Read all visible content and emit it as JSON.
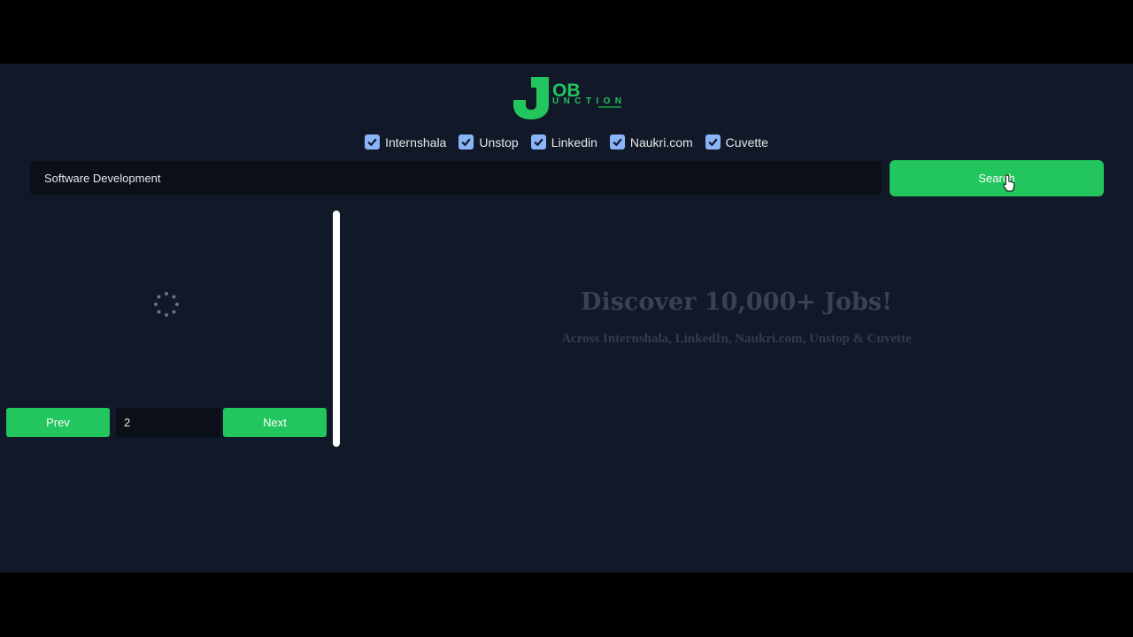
{
  "brand": {
    "logo_letter": "J",
    "logo_top": "OB",
    "logo_bottom": "UNCTION",
    "accent": "#22c55e",
    "background": "#111827"
  },
  "sources": [
    {
      "label": "Internshala",
      "checked": true
    },
    {
      "label": "Unstop",
      "checked": true
    },
    {
      "label": "Linkedin",
      "checked": true
    },
    {
      "label": "Naukri.com",
      "checked": true
    },
    {
      "label": "Cuvette",
      "checked": true
    }
  ],
  "search": {
    "value": "Software Development",
    "button_label": "Search"
  },
  "pager": {
    "prev_label": "Prev",
    "page_value": "2",
    "next_label": "Next"
  },
  "hero": {
    "title": "Discover 10,000+ Jobs!",
    "subtitle": "Across Internshala, LinkedIn, Naukri.com, Unstop & Cuvette"
  },
  "icons": {
    "loading": "spinner-icon",
    "cursor": "hand-pointer-icon",
    "checkbox": "checkmark-icon"
  }
}
